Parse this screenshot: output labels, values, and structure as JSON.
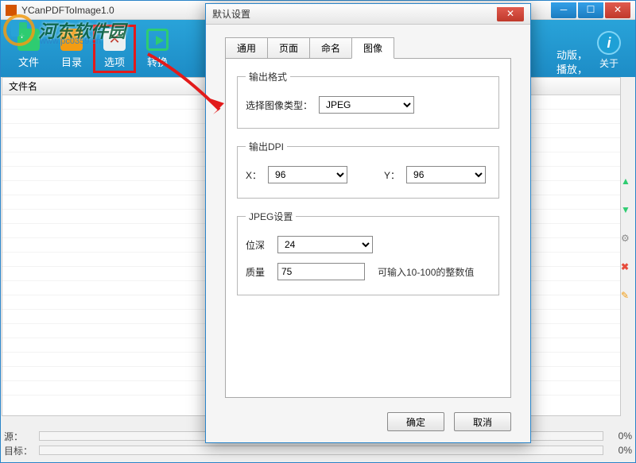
{
  "mainWindow": {
    "title": "YCanPDFToImage1.0",
    "toolbar": {
      "file": "文件",
      "dir": "目录",
      "options": "选项",
      "convert": "转换",
      "about": "关于"
    },
    "sideText": "动版，\n播放，",
    "listHeader": {
      "filename": "文件名"
    },
    "status": {
      "sourceLabel": "源：",
      "targetLabel": "目标：",
      "sourcePct": "0%",
      "targetPct": "0%"
    }
  },
  "dialog": {
    "title": "默认设置",
    "tabs": {
      "general": "通用",
      "page": "页面",
      "naming": "命名",
      "image": "图像"
    },
    "outputFormat": {
      "legend": "输出格式",
      "label": "选择图像类型：",
      "value": "JPEG"
    },
    "outputDpi": {
      "legend": "输出DPI",
      "xLabel": "X：",
      "xValue": "96",
      "yLabel": "Y：",
      "yValue": "96"
    },
    "jpegSettings": {
      "legend": "JPEG设置",
      "bitDepthLabel": "位深",
      "bitDepthValue": "24",
      "qualityLabel": "质量",
      "qualityValue": "75",
      "qualityHint": "可输入10-100的整数值"
    },
    "buttons": {
      "ok": "确定",
      "cancel": "取消"
    }
  },
  "watermark": {
    "text": "河东软件园",
    "sub": "www.pc0359.cn"
  }
}
